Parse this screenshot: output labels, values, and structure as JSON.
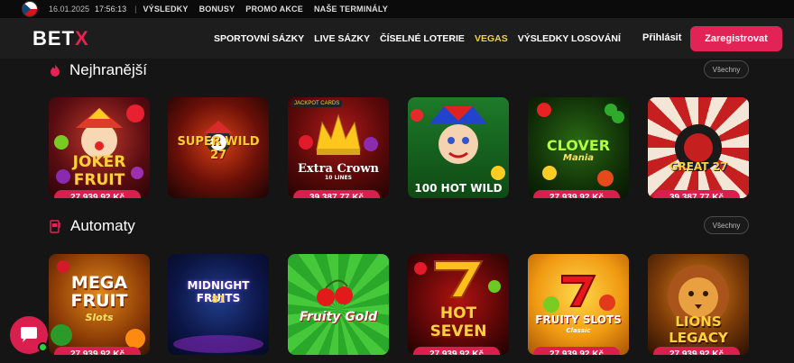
{
  "topbar": {
    "date": "16.01.2025",
    "time": "17:56:13",
    "links": [
      "VÝSLEDKY",
      "BONUSY",
      "PROMO AKCE",
      "NAŠE TERMINÁLY"
    ]
  },
  "header": {
    "logo_text_a": "BET",
    "logo_text_b": "X",
    "nav": [
      "SPORTOVNÍ SÁZKY",
      "LIVE SÁZKY",
      "ČÍSELNÉ LOTERIE",
      "VEGAS",
      "VÝSLEDKY LOSOVÁNÍ"
    ],
    "active_nav": "VEGAS",
    "login_label": "Přihlásit",
    "register_label": "Zaregistrovat"
  },
  "sections": [
    {
      "title": "Nejhranější",
      "all_label": "Všechny",
      "games": [
        {
          "name": "JOKER FRUIT",
          "jackpot": "27 939,92 Kč"
        },
        {
          "name": "SUPER WILD 27",
          "jackpot": ""
        },
        {
          "name": "Extra Crown",
          "sub": "10 LINES",
          "badge": "JACKPOT CARDS",
          "jackpot": "39 387,77 Kč"
        },
        {
          "name": "100 HOT WILD",
          "jackpot": ""
        },
        {
          "name": "CLOVER",
          "sub": "Mania",
          "jackpot": "27 939,92 Kč"
        },
        {
          "name": "GREAT 27",
          "jackpot": "39 387,77 Kč"
        }
      ]
    },
    {
      "title": "Automaty",
      "all_label": "Všechny",
      "games": [
        {
          "name": "MEGA FRUIT",
          "sub": "Slots",
          "jackpot": "27 939,92 Kč"
        },
        {
          "name": "MIDNIGHT FRUITS",
          "sub": "81",
          "jackpot": ""
        },
        {
          "name": "Fruity Gold",
          "jackpot": ""
        },
        {
          "name": "HOT SEVEN",
          "jackpot": "27 939,92 Kč"
        },
        {
          "name": "FRUITY SLOTS",
          "sub": "Classic",
          "jackpot": "27 939,92 Kč"
        },
        {
          "name": "LIONS LEGACY",
          "jackpot": "27 939,92 Kč"
        }
      ]
    }
  ],
  "colors": {
    "accent": "#e12455",
    "nav_active": "#f0d348",
    "online": "#2bd43b"
  }
}
